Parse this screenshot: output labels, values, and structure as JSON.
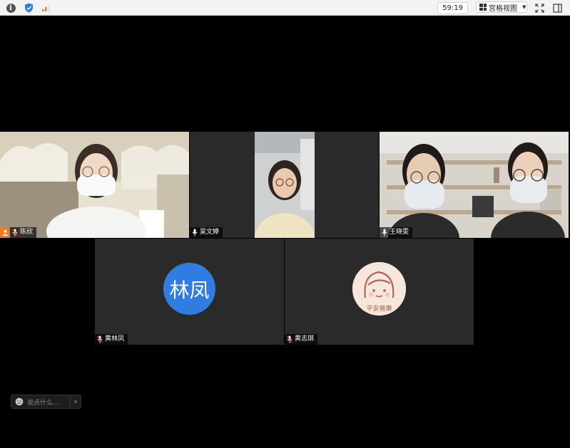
{
  "toolbar": {
    "timer": "59:19",
    "view_label": "宫格视图"
  },
  "participants": [
    {
      "name": "陈欣",
      "is_host": true
    },
    {
      "name": "吴文婷"
    },
    {
      "name": "王晓雯",
      "active_speaker": true
    },
    {
      "name": "黄林凤",
      "avatar_text": "林凤"
    },
    {
      "name": "黄志琪",
      "avatar_text": "平安喜樂"
    }
  ],
  "chat": {
    "placeholder": "说点什么..."
  },
  "colors": {
    "active_border": "#3ac45c",
    "avatar_blue": "#2f7de1",
    "host_orange": "#f07a20"
  }
}
